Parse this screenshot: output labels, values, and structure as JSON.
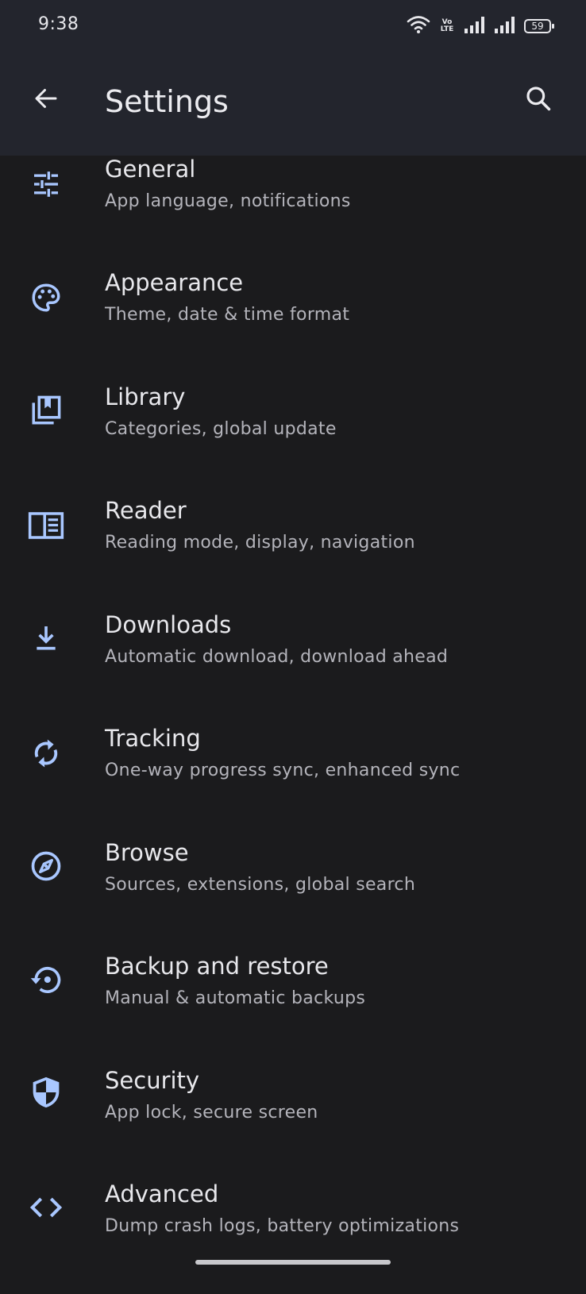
{
  "status": {
    "time": "9:38",
    "volte_top": "Vo",
    "volte_bottom": "LTE",
    "battery": "59"
  },
  "appbar": {
    "title": "Settings",
    "back_icon": "arrow-left-icon",
    "search_icon": "search-icon"
  },
  "items": [
    {
      "label": "General",
      "sub": "App language, notifications",
      "icon": "tune-icon"
    },
    {
      "label": "Appearance",
      "sub": "Theme, date & time format",
      "icon": "palette-icon"
    },
    {
      "label": "Library",
      "sub": "Categories, global update",
      "icon": "library-icon"
    },
    {
      "label": "Reader",
      "sub": "Reading mode, display, navigation",
      "icon": "book-open-icon"
    },
    {
      "label": "Downloads",
      "sub": "Automatic download, download ahead",
      "icon": "download-icon"
    },
    {
      "label": "Tracking",
      "sub": "One-way progress sync, enhanced sync",
      "icon": "sync-icon"
    },
    {
      "label": "Browse",
      "sub": "Sources, extensions, global search",
      "icon": "compass-icon"
    },
    {
      "label": "Backup and restore",
      "sub": "Manual & automatic backups",
      "icon": "backup-restore-icon"
    },
    {
      "label": "Security",
      "sub": "App lock, secure screen",
      "icon": "shield-icon"
    },
    {
      "label": "Advanced",
      "sub": "Dump crash logs, battery optimizations",
      "icon": "code-icon"
    }
  ],
  "colors": {
    "accent": "#a9c7ff",
    "background": "#1b1b1d",
    "appbar": "#23252d"
  }
}
